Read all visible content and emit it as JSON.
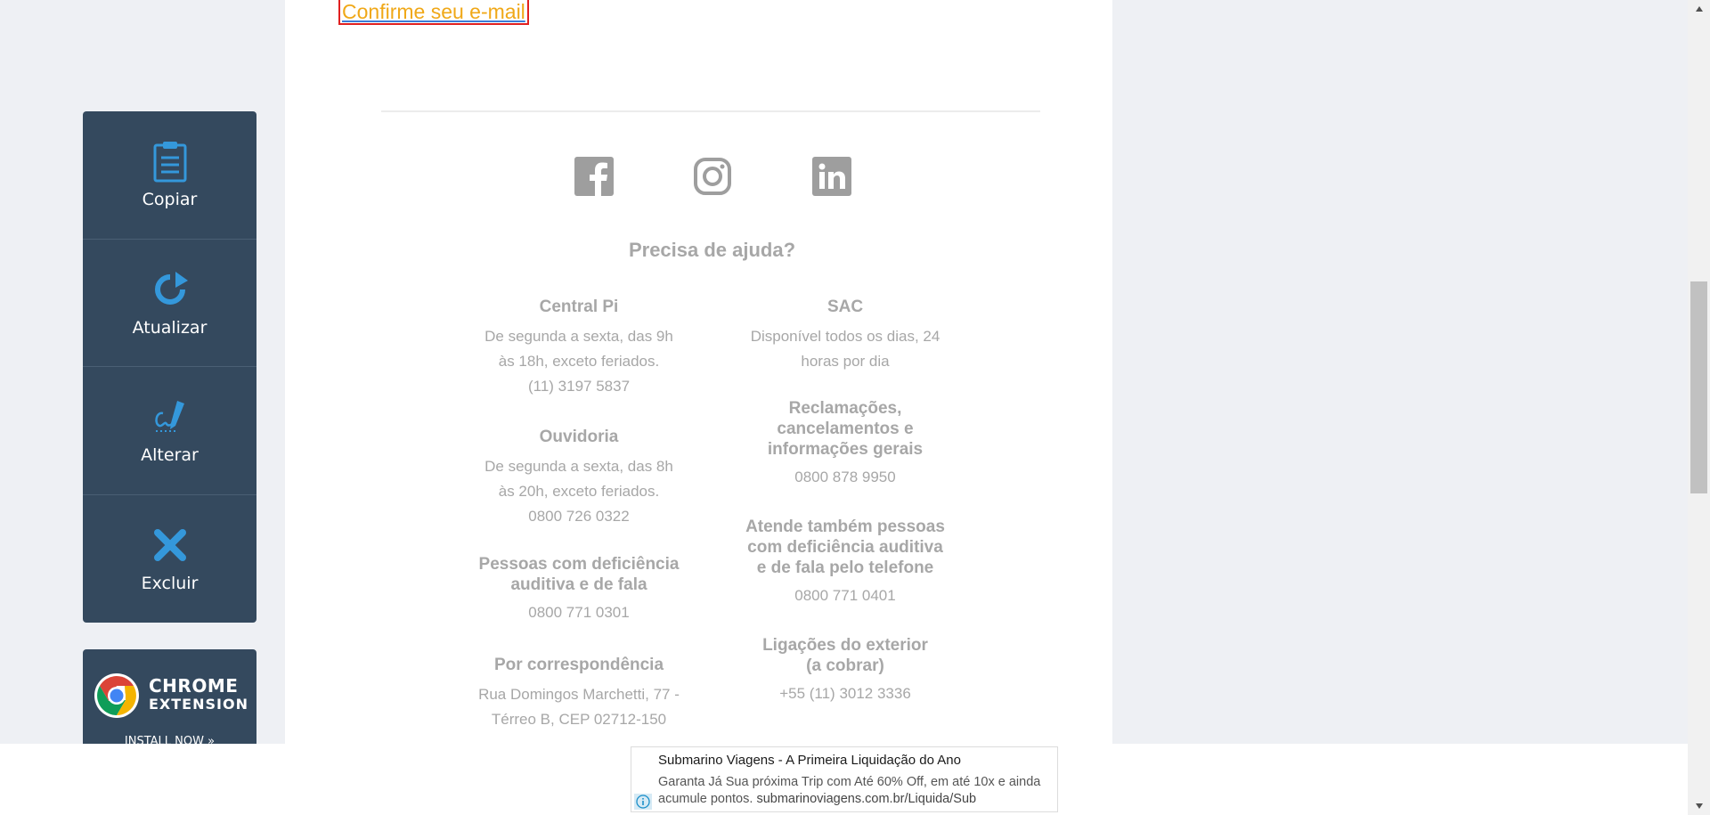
{
  "toolbar": {
    "items": [
      {
        "label": "Copiar",
        "icon": "clipboard-icon"
      },
      {
        "label": "Atualizar",
        "icon": "refresh-icon"
      },
      {
        "label": "Alterar",
        "icon": "signature-pen-icon"
      },
      {
        "label": "Excluir",
        "icon": "close-x-icon"
      }
    ],
    "accent_color": "#3498db",
    "background_color": "#34495e"
  },
  "chrome_extension": {
    "line1": "CHROME",
    "line2": "EXTENSION",
    "cta": "INSTALL NOW »"
  },
  "email": {
    "confirm_link": "Confirme seu e-mail",
    "social": [
      "facebook-icon",
      "instagram-icon",
      "linkedin-icon"
    ],
    "help_title": "Precisa de ajuda?",
    "left_col": {
      "central_title": "Central Pi",
      "central_line1": "De segunda a sexta, das 9h",
      "central_line2": "às 18h, exceto feriados.",
      "central_phone": "(11) 3197 5837",
      "ouvidoria_title": "Ouvidoria",
      "ouvidoria_line1": "De segunda a sexta, das 8h",
      "ouvidoria_line2": "às 20h, exceto feriados.",
      "ouvidoria_phone": "0800 726 0322",
      "pcd_title1": "Pessoas com deficiência",
      "pcd_title2": "auditiva e de fala",
      "pcd_phone": "0800 771 0301",
      "corresp_title": "Por correspondência",
      "corresp_line1": "Rua Domingos Marchetti, 77 -",
      "corresp_line2": "Térreo B, CEP 02712-150"
    },
    "right_col": {
      "sac_title": "SAC",
      "sac_line1": "Disponível todos os dias, 24",
      "sac_line2": "horas por dia",
      "recl_title1": "Reclamações,",
      "recl_title2": "cancelamentos e",
      "recl_title3": "informações gerais",
      "recl_phone": "0800 878 9950",
      "atende_title1": "Atende também pessoas",
      "atende_title2": "com deficiência auditiva",
      "atende_title3": "e de fala pelo telefone",
      "atende_phone": "0800 771 0401",
      "ext_title1": "Ligações do exterior",
      "ext_title2": "(a cobrar)",
      "ext_phone": "+55 (11) 3012 3336"
    },
    "text_color": "#a7a7a7",
    "link_color": "#f0a818"
  },
  "ad": {
    "title": "Submarino Viagens - A Primeira Liquidação do Ano",
    "desc": "Garanta Já Sua próxima Trip com Até 60% Off, em até 10x e ainda acumule pontos.",
    "url": "submarinoviagens.com.br/Liquida/Sub",
    "info_icon": "info-icon"
  }
}
